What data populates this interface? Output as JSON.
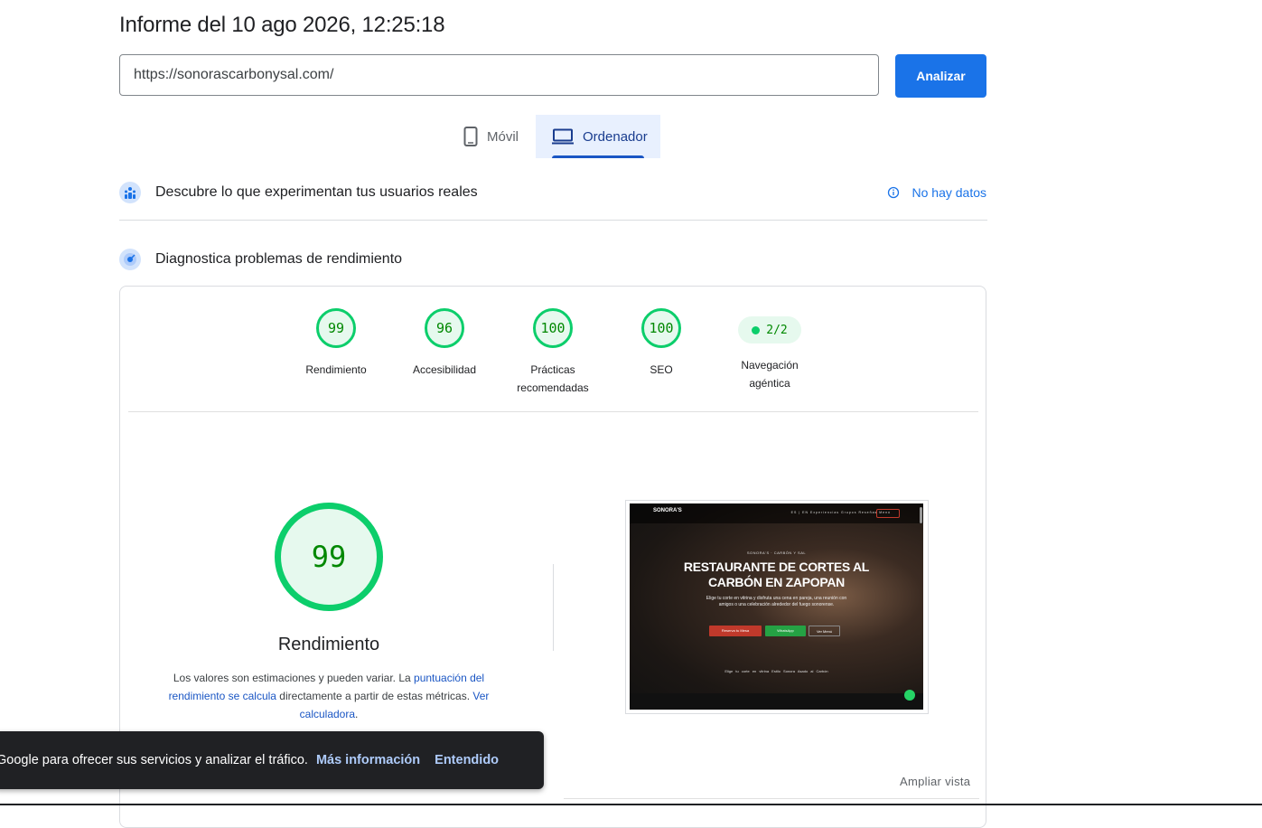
{
  "report": {
    "title": "Informe del 10 ago 2026, 12:25:18",
    "url_value": "https://sonorascarbonysal.com/",
    "analyze_label": "Analizar"
  },
  "tabs": [
    {
      "label": "Móvil",
      "icon": "smartphone-icon",
      "selected": false
    },
    {
      "label": "Ordenador",
      "icon": "laptop-icon",
      "selected": true
    }
  ],
  "field_data": {
    "title": "Descubre lo que experimentan tus usuarios reales",
    "status": "No hay datos",
    "icon": "users-icon"
  },
  "diagnostics": {
    "title": "Diagnostica problemas de rendimiento",
    "icon": "radar-icon"
  },
  "scores": [
    {
      "value": "99",
      "label": "Rendimiento"
    },
    {
      "value": "96",
      "label": "Accesibilidad"
    },
    {
      "value": "100",
      "label": "Prácticas recomendadas"
    },
    {
      "value": "100",
      "label": "SEO"
    }
  ],
  "agentic": {
    "value": "2/2",
    "label": "Navegación agéntica"
  },
  "performance": {
    "score": "99",
    "label": "Rendimiento",
    "note_prefix": "Los valores son estimaciones y pueden variar. La ",
    "note_link1": "puntuación del rendimiento se calcula",
    "note_middle": " directamente a partir de estas métricas. ",
    "note_link2": "Ver calculadora",
    "note_suffix": "."
  },
  "screenshot": {
    "logo": "SONORA'S",
    "nav_links": "ES | EN   Experiencias   Grupos   Reseñas   Menú",
    "kicker": "SONORA'S · CARBÓN Y SAL",
    "headline": "RESTAURANTE DE CORTES AL CARBÓN EN ZAPOPAN",
    "sub": "Elige tu corte en vitrina y disfruta una cena en pareja, una reunión con amigos o una celebración alrededor del fuego sonorense.",
    "btn1": "Reserva tu Mesa",
    "btn2": "WhatsApp",
    "btn3": "Ver Menú",
    "features": "Elige tu corte en vitrina   Estilo Sonora   Asado al Carbón"
  },
  "expand_label": "Ampliar vista",
  "toast": {
    "message": "Google para ofrecer sus servicios y analizar el tráfico.",
    "more": "Más información",
    "ok": "Entendido"
  },
  "colors": {
    "accent": "#1a73e8",
    "pass_green": "#0cce6b",
    "pass_text": "#008800"
  }
}
